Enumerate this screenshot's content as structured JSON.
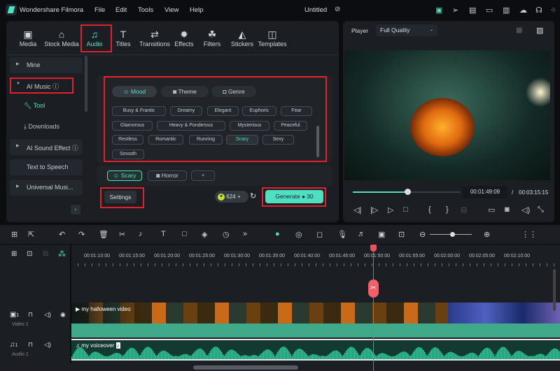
{
  "app": {
    "name": "Wondershare Filmora",
    "project_title": "Untitled"
  },
  "menu": [
    "File",
    "Edit",
    "Tools",
    "View",
    "Help"
  ],
  "tabs": [
    {
      "label": "Media",
      "icon": "media-icon"
    },
    {
      "label": "Stock Media",
      "icon": "stock-media-icon"
    },
    {
      "label": "Audio",
      "icon": "music-note-icon",
      "active": true
    },
    {
      "label": "Titles",
      "icon": "titles-icon"
    },
    {
      "label": "Transitions",
      "icon": "transitions-icon"
    },
    {
      "label": "Effects",
      "icon": "effects-icon"
    },
    {
      "label": "Filters",
      "icon": "filters-icon"
    },
    {
      "label": "Stickers",
      "icon": "stickers-icon"
    },
    {
      "label": "Templates",
      "icon": "templates-icon"
    }
  ],
  "sidebar": {
    "items": [
      {
        "label": "Mine"
      },
      {
        "label": "AI Music"
      },
      {
        "label": "Tool"
      },
      {
        "label": "Downloads"
      },
      {
        "label": "AI Sound Effect"
      },
      {
        "label": "Text to Speech"
      },
      {
        "label": "Universal Musi..."
      }
    ]
  },
  "ai_music": {
    "category_tabs": [
      "Mood",
      "Theme",
      "Genre"
    ],
    "moods": [
      "Busy & Frantic",
      "Dreamy",
      "Elegant",
      "Euphoric",
      "Fear",
      "Glamorous",
      "Heavy & Ponderous",
      "Mysterious",
      "Peaceful",
      "Restless",
      "Romantic",
      "Running",
      "Scary",
      "Sexy",
      "Smooth"
    ],
    "selected_mood": "Scary",
    "selected_tags": [
      "Scary",
      "Horror"
    ],
    "add_tag": "+",
    "settings_label": "Settings",
    "credits": "624",
    "generate_label": "Generate",
    "generate_cost": "30",
    "accent": "#4fe0c0"
  },
  "player": {
    "label": "Player",
    "quality": "Full Quality",
    "current_time": "00:01:49:09",
    "separator": "/",
    "total_time": "00:03:15:15",
    "progress": 0.56
  },
  "timeline": {
    "ruler": [
      "00:01:10:00",
      "00:01:15:00",
      "00:01:20:00",
      "00:01:25:00",
      "00:01:30:00",
      "00:01:35:00",
      "00:01:40:00",
      "00:01:45:00",
      "00:01:50:00",
      "00:01:55:00",
      "00:02:00:00",
      "00:02:05:00",
      "00:02:10:00"
    ],
    "tracks": [
      {
        "name": "Video 1",
        "num": "1",
        "clip": "my halloween video"
      },
      {
        "name": "Audio 1",
        "num": "1",
        "clip": "my voiceover"
      }
    ],
    "playhead_color": "#f0505a"
  }
}
